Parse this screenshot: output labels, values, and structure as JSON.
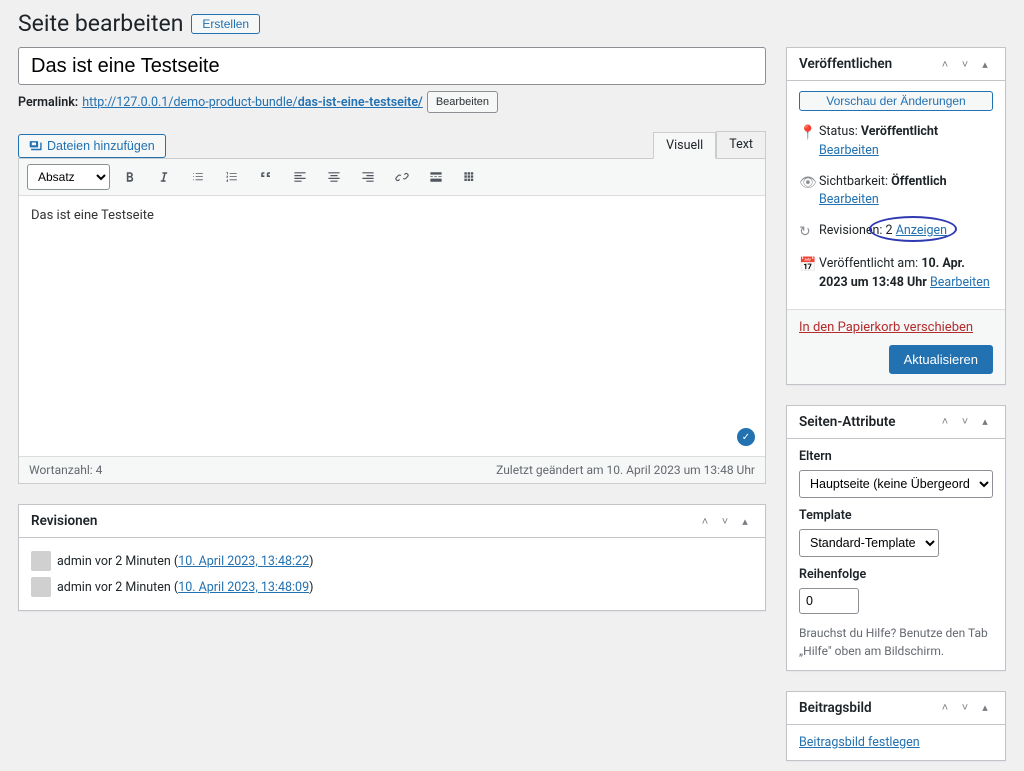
{
  "header": {
    "title": "Seite bearbeiten",
    "create_btn": "Erstellen"
  },
  "title_field": {
    "value": "Das ist eine Testseite"
  },
  "permalink": {
    "label": "Permalink:",
    "base": "http://127.0.0.1/demo-product-bundle/",
    "slug": "das-ist-eine-testseite/",
    "edit_btn": "Bearbeiten"
  },
  "media_btn": "Dateien hinzufügen",
  "tabs": {
    "visual": "Visuell",
    "text": "Text"
  },
  "format_select": "Absatz",
  "content_text": "Das ist eine Testseite",
  "word_count": {
    "label": "Wortanzahl:",
    "value": "4"
  },
  "last_edited": "Zuletzt geändert am 10. April 2023 um 13:48 Uhr",
  "revisions_box": {
    "title": "Revisionen",
    "items": [
      {
        "author": "admin",
        "ago": "vor 2 Minuten",
        "ts": "10. April 2023, 13:48:22"
      },
      {
        "author": "admin",
        "ago": "vor 2 Minuten",
        "ts": "10. April 2023, 13:48:09"
      }
    ]
  },
  "publish_box": {
    "title": "Veröffentlichen",
    "preview_btn": "Vorschau der Änderungen",
    "status_label": "Status:",
    "status_value": "Veröffentlicht",
    "visibility_label": "Sichtbarkeit:",
    "visibility_value": "Öffentlich",
    "revisions_label": "Revisionen:",
    "revisions_count": "2",
    "revisions_view": "Anzeigen",
    "published_label": "Veröffentlicht am:",
    "published_value": "10. Apr. 2023 um 13:48 Uhr",
    "edit_link": "Bearbeiten",
    "trash_link": "In den Papierkorb verschieben",
    "update_btn": "Aktualisieren"
  },
  "attributes_box": {
    "title": "Seiten-Attribute",
    "parent_label": "Eltern",
    "parent_value": "Hauptseite (keine Übergeordnete)",
    "template_label": "Template",
    "template_value": "Standard-Template",
    "order_label": "Reihenfolge",
    "order_value": "0",
    "help_text": "Brauchst du Hilfe? Benutze den Tab „Hilfe\" oben am Bildschirm."
  },
  "thumbnail_box": {
    "title": "Beitragsbild",
    "set_link": "Beitragsbild festlegen"
  }
}
